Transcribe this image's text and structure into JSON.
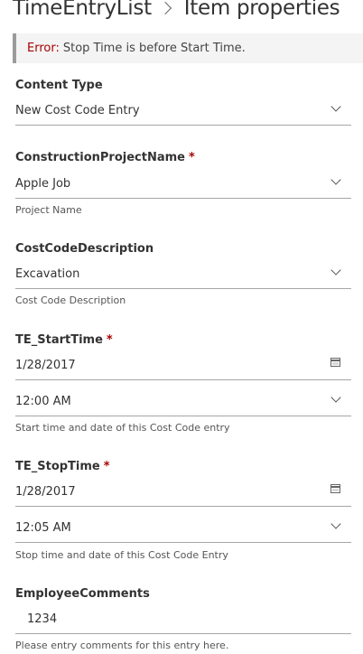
{
  "breadcrumb": {
    "list": "TimeEntryList",
    "page": "Item properties"
  },
  "error": {
    "label": "Error:",
    "message": "Stop Time is before Start Time."
  },
  "content_type": {
    "label": "Content Type",
    "value": "New Cost Code Entry"
  },
  "project": {
    "label": "ConstructionProjectName",
    "required": "*",
    "value": "Apple Job",
    "help": "Project Name"
  },
  "cost_code": {
    "label": "CostCodeDescription",
    "value": "Excavation",
    "help": "Cost Code Description"
  },
  "start": {
    "label": "TE_StartTime",
    "required": "*",
    "date": "1/28/2017",
    "time": "12:00 AM",
    "help": "Start time and date of this Cost Code entry"
  },
  "stop": {
    "label": "TE_StopTime",
    "required": "*",
    "date": "1/28/2017",
    "time": "12:05 AM",
    "help": "Stop time and date of this Cost Code Entry"
  },
  "comments": {
    "label": "EmployeeComments",
    "value": "1234",
    "help": "Please entry comments for this entry here."
  }
}
